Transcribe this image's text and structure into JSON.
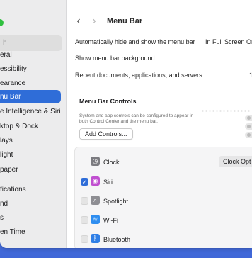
{
  "window": {
    "title": "Menu Bar",
    "back_symbol": "‹",
    "forward_symbol": "›"
  },
  "sidebar": {
    "search_placeholder": "h",
    "items": [
      {
        "label": "eral",
        "active": false
      },
      {
        "label": "essibility",
        "active": false
      },
      {
        "label": "earance",
        "active": false
      },
      {
        "label": "nu Bar",
        "active": true
      },
      {
        "label": "e Intelligence & Siri",
        "active": false
      },
      {
        "label": "ktop & Dock",
        "active": false
      },
      {
        "label": "lays",
        "active": false
      },
      {
        "label": "light",
        "active": false
      },
      {
        "label": "paper",
        "active": false
      },
      {
        "label": "fications",
        "active": false
      },
      {
        "label": "nd",
        "active": false
      },
      {
        "label": "s",
        "active": false
      },
      {
        "label": "en Time",
        "active": false
      }
    ]
  },
  "settings": {
    "autohide_label": "Automatically hide and show the menu bar",
    "autohide_value": "In Full Screen On",
    "background_label": "Show menu bar background",
    "recent_label": "Recent documents, applications, and servers",
    "recent_value": "1"
  },
  "controls_section": {
    "title": "Menu Bar Controls",
    "description": "System and app controls can be configured to appear in both Control Center and the menu bar.",
    "add_button": "Add Controls..."
  },
  "controls": [
    {
      "name": "Clock",
      "checked": null,
      "icon": "clock-icon",
      "glyph": "◷",
      "color": "#7b7b80",
      "option": "Clock Opt"
    },
    {
      "name": "Siri",
      "checked": true,
      "icon": "siri-icon",
      "glyph": "◉",
      "color": "#c04fd0"
    },
    {
      "name": "Spotlight",
      "checked": false,
      "icon": "spotlight-icon",
      "glyph": "⌕",
      "color": "#8e8e93"
    },
    {
      "name": "Wi-Fi",
      "checked": false,
      "icon": "wifi-icon",
      "glyph": "≋",
      "color": "#2f8ef0"
    },
    {
      "name": "Bluetooth",
      "checked": false,
      "icon": "bluetooth-icon",
      "glyph": "ᛒ",
      "color": "#2f7fe6"
    }
  ],
  "colors": {
    "accent": "#2f6dd8",
    "wallpaper": "#5b7fe3",
    "status_dot": "#30c03f"
  }
}
